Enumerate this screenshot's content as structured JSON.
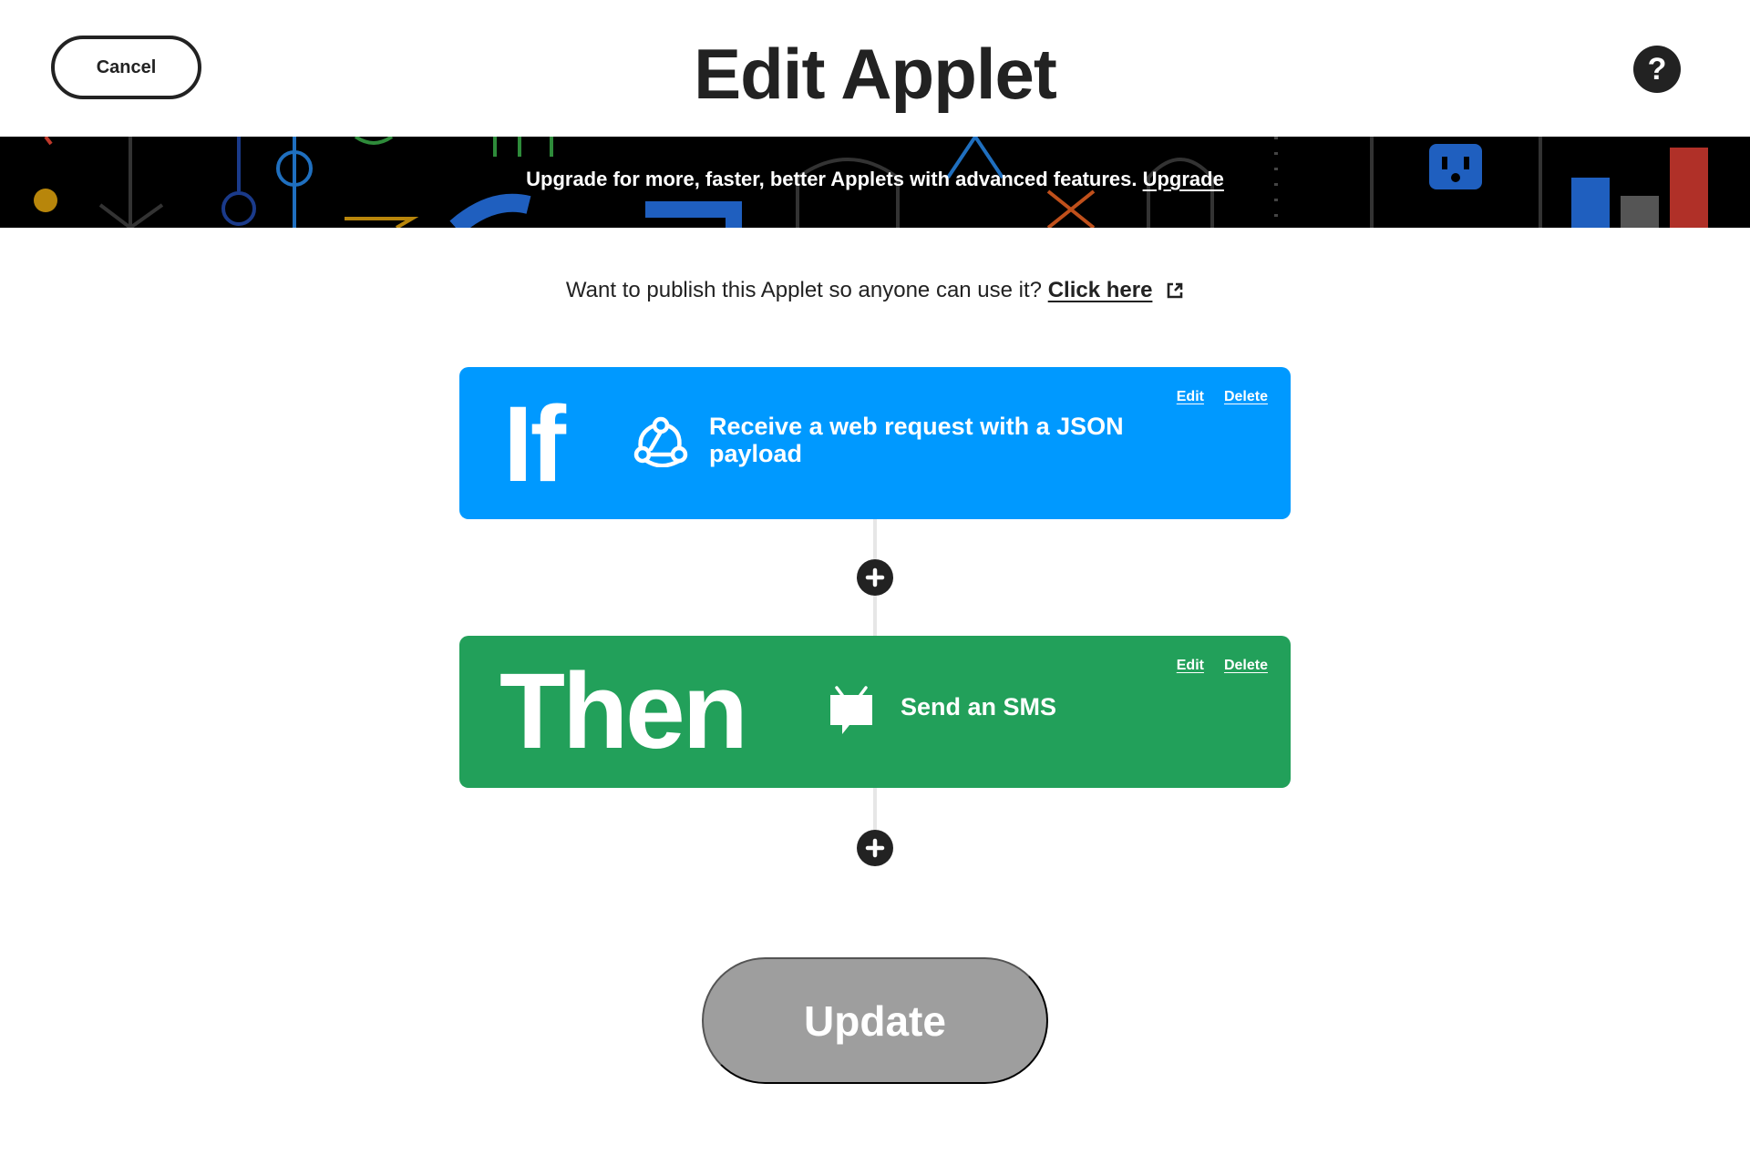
{
  "header": {
    "cancel_label": "Cancel",
    "title": "Edit Applet",
    "help_label": "?"
  },
  "banner": {
    "text": "Upgrade for more, faster, better Applets with advanced features.",
    "link_label": "Upgrade"
  },
  "publish": {
    "text": "Want to publish this Applet so anyone can use it?",
    "link_label": "Click here",
    "link_icon": "external-link-icon"
  },
  "trigger": {
    "keyword": "If",
    "service_icon": "webhooks-icon",
    "description": "Receive a web request with a JSON payload",
    "edit_label": "Edit",
    "delete_label": "Delete",
    "color": "#0099ff"
  },
  "action": {
    "keyword": "Then",
    "service_icon": "sms-icon",
    "description": "Send an SMS",
    "edit_label": "Edit",
    "delete_label": "Delete",
    "color": "#22a05a"
  },
  "add_step_icon": "plus-icon",
  "update_label": "Update",
  "colors": {
    "text": "#222222",
    "update_disabled": "#9e9e9e",
    "banner_bg": "#000000"
  }
}
